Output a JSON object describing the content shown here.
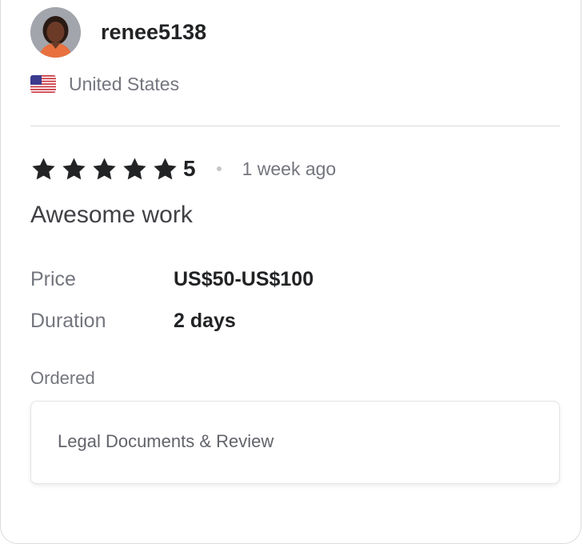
{
  "review": {
    "username": "renee5138",
    "country": "United States",
    "rating": "5",
    "star_count": 5,
    "time_ago": "1 week ago",
    "text": "Awesome work",
    "details": {
      "price_label": "Price",
      "price_value": "US$50-US$100",
      "duration_label": "Duration",
      "duration_value": "2 days"
    },
    "ordered": {
      "label": "Ordered",
      "item": "Legal Documents & Review"
    }
  },
  "icons": {
    "avatar": "avatar",
    "flag": "us-flag-icon",
    "star": "star-icon"
  },
  "colors": {
    "text_primary": "#222325",
    "text_secondary": "#74767e",
    "divider": "#dadbdd",
    "star": "#222325"
  }
}
